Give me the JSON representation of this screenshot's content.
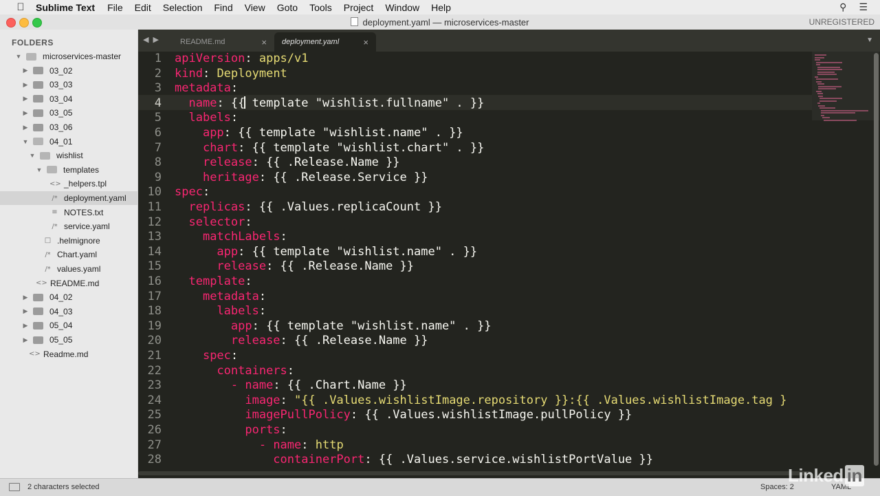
{
  "menubar": {
    "app_name": "Sublime Text",
    "items": [
      "File",
      "Edit",
      "Selection",
      "Find",
      "View",
      "Goto",
      "Tools",
      "Project",
      "Window",
      "Help"
    ],
    "apple_icon": "apple-icon",
    "search_icon": "search-icon",
    "list_icon": "list-icon"
  },
  "window": {
    "title": "deployment.yaml — microservices-master",
    "unregistered": "UNREGISTERED"
  },
  "sidebar": {
    "header": "FOLDERS",
    "items": [
      {
        "label": "microservices-master",
        "kind": "folder",
        "expanded": true,
        "depth": 0
      },
      {
        "label": "03_02",
        "kind": "folder",
        "expanded": false,
        "depth": 1
      },
      {
        "label": "03_03",
        "kind": "folder",
        "expanded": false,
        "depth": 1
      },
      {
        "label": "03_04",
        "kind": "folder",
        "expanded": false,
        "depth": 1
      },
      {
        "label": "03_05",
        "kind": "folder",
        "expanded": false,
        "depth": 1
      },
      {
        "label": "03_06",
        "kind": "folder",
        "expanded": false,
        "depth": 1
      },
      {
        "label": "04_01",
        "kind": "folder",
        "expanded": true,
        "depth": 1
      },
      {
        "label": "wishlist",
        "kind": "folder",
        "expanded": true,
        "depth": 2
      },
      {
        "label": "templates",
        "kind": "folder",
        "expanded": true,
        "depth": 3
      },
      {
        "label": "_helpers.tpl",
        "kind": "file",
        "icon": "<>",
        "depth": 4
      },
      {
        "label": "deployment.yaml",
        "kind": "file",
        "icon": "/*",
        "depth": 4,
        "selected": true
      },
      {
        "label": "NOTES.txt",
        "kind": "file",
        "icon": "≡",
        "depth": 4
      },
      {
        "label": "service.yaml",
        "kind": "file",
        "icon": "/*",
        "depth": 4
      },
      {
        "label": ".helmignore",
        "kind": "file",
        "icon": "□",
        "depth": 3
      },
      {
        "label": "Chart.yaml",
        "kind": "file",
        "icon": "/*",
        "depth": 3
      },
      {
        "label": "values.yaml",
        "kind": "file",
        "icon": "/*",
        "depth": 3
      },
      {
        "label": "README.md",
        "kind": "file",
        "icon": "<>",
        "depth": 2
      },
      {
        "label": "04_02",
        "kind": "folder",
        "expanded": false,
        "depth": 1
      },
      {
        "label": "04_03",
        "kind": "folder",
        "expanded": false,
        "depth": 1
      },
      {
        "label": "05_04",
        "kind": "folder",
        "expanded": false,
        "depth": 1
      },
      {
        "label": "05_05",
        "kind": "folder",
        "expanded": false,
        "depth": 1
      },
      {
        "label": "Readme.md",
        "kind": "file",
        "icon": "<>",
        "depth": 1
      }
    ]
  },
  "tabs": [
    {
      "label": "README.md",
      "active": false
    },
    {
      "label": "deployment.yaml",
      "active": true
    }
  ],
  "editor": {
    "current_line": 4,
    "lines": [
      [
        [
          "k",
          "apiVersion"
        ],
        [
          "t",
          ": "
        ],
        [
          "s",
          "apps/v1"
        ]
      ],
      [
        [
          "k",
          "kind"
        ],
        [
          "t",
          ": "
        ],
        [
          "s",
          "Deployment"
        ]
      ],
      [
        [
          "k",
          "metadata"
        ],
        [
          "t",
          ":"
        ]
      ],
      [
        [
          "t",
          "  "
        ],
        [
          "k",
          "name"
        ],
        [
          "t",
          ": {{"
        ],
        [
          "c",
          ""
        ],
        [
          "t",
          " template \"wishlist.fullname\" . }}"
        ]
      ],
      [
        [
          "t",
          "  "
        ],
        [
          "k",
          "labels"
        ],
        [
          "t",
          ":"
        ]
      ],
      [
        [
          "t",
          "    "
        ],
        [
          "k",
          "app"
        ],
        [
          "t",
          ": {{ template \"wishlist.name\" . }}"
        ]
      ],
      [
        [
          "t",
          "    "
        ],
        [
          "k",
          "chart"
        ],
        [
          "t",
          ": {{ template \"wishlist.chart\" . }}"
        ]
      ],
      [
        [
          "t",
          "    "
        ],
        [
          "k",
          "release"
        ],
        [
          "t",
          ": {{ .Release.Name }}"
        ]
      ],
      [
        [
          "t",
          "    "
        ],
        [
          "k",
          "heritage"
        ],
        [
          "t",
          ": {{ .Release.Service }}"
        ]
      ],
      [
        [
          "k",
          "spec"
        ],
        [
          "t",
          ":"
        ]
      ],
      [
        [
          "t",
          "  "
        ],
        [
          "k",
          "replicas"
        ],
        [
          "t",
          ": {{ .Values.replicaCount }}"
        ]
      ],
      [
        [
          "t",
          "  "
        ],
        [
          "k",
          "selector"
        ],
        [
          "t",
          ":"
        ]
      ],
      [
        [
          "t",
          "    "
        ],
        [
          "k",
          "matchLabels"
        ],
        [
          "t",
          ":"
        ]
      ],
      [
        [
          "t",
          "      "
        ],
        [
          "k",
          "app"
        ],
        [
          "t",
          ": {{ template \"wishlist.name\" . }}"
        ]
      ],
      [
        [
          "t",
          "      "
        ],
        [
          "k",
          "release"
        ],
        [
          "t",
          ": {{ .Release.Name }}"
        ]
      ],
      [
        [
          "t",
          "  "
        ],
        [
          "k",
          "template"
        ],
        [
          "t",
          ":"
        ]
      ],
      [
        [
          "t",
          "    "
        ],
        [
          "k",
          "metadata"
        ],
        [
          "t",
          ":"
        ]
      ],
      [
        [
          "t",
          "      "
        ],
        [
          "k",
          "labels"
        ],
        [
          "t",
          ":"
        ]
      ],
      [
        [
          "t",
          "        "
        ],
        [
          "k",
          "app"
        ],
        [
          "t",
          ": {{ template \"wishlist.name\" . }}"
        ]
      ],
      [
        [
          "t",
          "        "
        ],
        [
          "k",
          "release"
        ],
        [
          "t",
          ": {{ .Release.Name }}"
        ]
      ],
      [
        [
          "t",
          "    "
        ],
        [
          "k",
          "spec"
        ],
        [
          "t",
          ":"
        ]
      ],
      [
        [
          "t",
          "      "
        ],
        [
          "k",
          "containers"
        ],
        [
          "t",
          ":"
        ]
      ],
      [
        [
          "t",
          "        "
        ],
        [
          "k",
          "- "
        ],
        [
          "k",
          "name"
        ],
        [
          "t",
          ": {{ .Chart.Name }}"
        ]
      ],
      [
        [
          "t",
          "          "
        ],
        [
          "k",
          "image"
        ],
        [
          "t",
          ": "
        ],
        [
          "s",
          "\"{{ .Values.wishlistImage.repository }}:{{ .Values.wishlistImage.tag }"
        ]
      ],
      [
        [
          "t",
          "          "
        ],
        [
          "k",
          "imagePullPolicy"
        ],
        [
          "t",
          ": {{ .Values.wishlistImage.pullPolicy }}"
        ]
      ],
      [
        [
          "t",
          "          "
        ],
        [
          "k",
          "ports"
        ],
        [
          "t",
          ":"
        ]
      ],
      [
        [
          "t",
          "            "
        ],
        [
          "k",
          "- "
        ],
        [
          "k",
          "name"
        ],
        [
          "t",
          ": "
        ],
        [
          "s",
          "http"
        ]
      ],
      [
        [
          "t",
          "              "
        ],
        [
          "k",
          "containerPort"
        ],
        [
          "t",
          ": {{ .Values.service.wishlistPortValue }}"
        ]
      ]
    ]
  },
  "statusbar": {
    "selection": "2 characters selected",
    "spaces": "Spaces: 2",
    "syntax": "YAML"
  },
  "watermark": {
    "text": "Linked",
    "badge": "in"
  }
}
